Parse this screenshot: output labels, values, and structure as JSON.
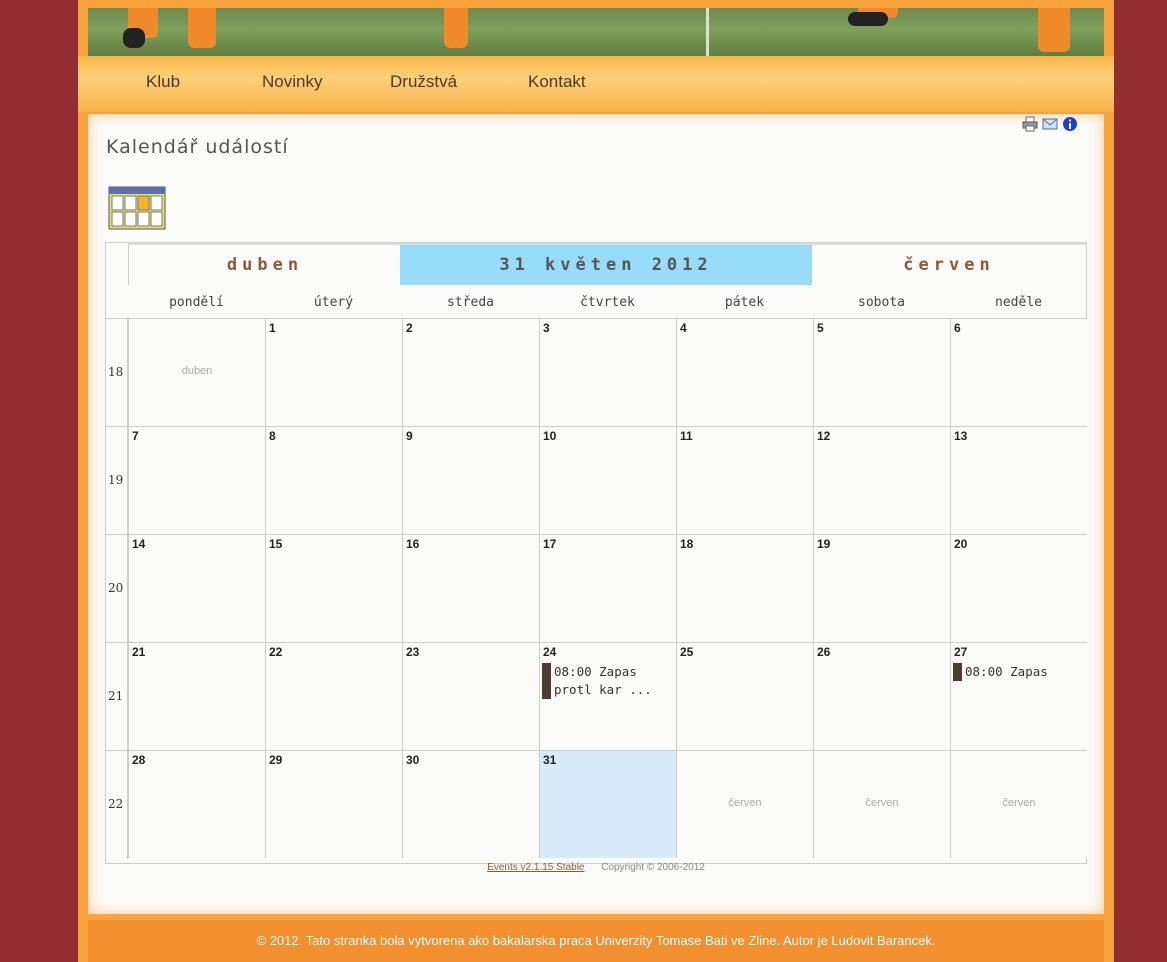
{
  "nav": {
    "items": [
      {
        "label": "Klub"
      },
      {
        "label": "Novinky"
      },
      {
        "label": "Družstvá"
      },
      {
        "label": "Kontakt"
      }
    ]
  },
  "page_title": "Kalendář událostí",
  "tools": [
    "print-icon",
    "email-icon",
    "info-icon"
  ],
  "calendar": {
    "prev_month": "duben",
    "current_month": "31 květen 2012",
    "next_month": "červen",
    "weekdays": [
      "pondělí",
      "úterý",
      "středa",
      "čtvrtek",
      "pátek",
      "sobota",
      "neděle"
    ],
    "weeks": [
      {
        "num": "18",
        "days": [
          {
            "other": "duben"
          },
          {
            "n": "1"
          },
          {
            "n": "2"
          },
          {
            "n": "3"
          },
          {
            "n": "4"
          },
          {
            "n": "5"
          },
          {
            "n": "6"
          }
        ]
      },
      {
        "num": "19",
        "days": [
          {
            "n": "7"
          },
          {
            "n": "8"
          },
          {
            "n": "9"
          },
          {
            "n": "10"
          },
          {
            "n": "11"
          },
          {
            "n": "12"
          },
          {
            "n": "13"
          }
        ]
      },
      {
        "num": "20",
        "days": [
          {
            "n": "14"
          },
          {
            "n": "15"
          },
          {
            "n": "16"
          },
          {
            "n": "17"
          },
          {
            "n": "18"
          },
          {
            "n": "19"
          },
          {
            "n": "20"
          }
        ]
      },
      {
        "num": "21",
        "days": [
          {
            "n": "21"
          },
          {
            "n": "22"
          },
          {
            "n": "23"
          },
          {
            "n": "24",
            "event": "08:00 Zapas protl kar ..."
          },
          {
            "n": "25"
          },
          {
            "n": "26"
          },
          {
            "n": "27",
            "event": "08:00 Zapas"
          }
        ]
      },
      {
        "num": "22",
        "days": [
          {
            "n": "28"
          },
          {
            "n": "29"
          },
          {
            "n": "30"
          },
          {
            "n": "31",
            "today": true
          },
          {
            "other": "červen"
          },
          {
            "other": "červen"
          },
          {
            "other": "červen"
          }
        ]
      }
    ],
    "footer_link": "Events v2.1.15 Stable",
    "footer_copy": "Copyright © 2006-2012"
  },
  "site_footer": "© 2012. Tato stranka bola vytvorena ako bakalarska praca Univerzity Tomase Bati ve Zline. Autor je Ludovit Barancek.",
  "colors": {
    "accent": "#f29030",
    "border": "#922d31",
    "today": "#d8ebfb",
    "current_month": "#99dcf9"
  }
}
